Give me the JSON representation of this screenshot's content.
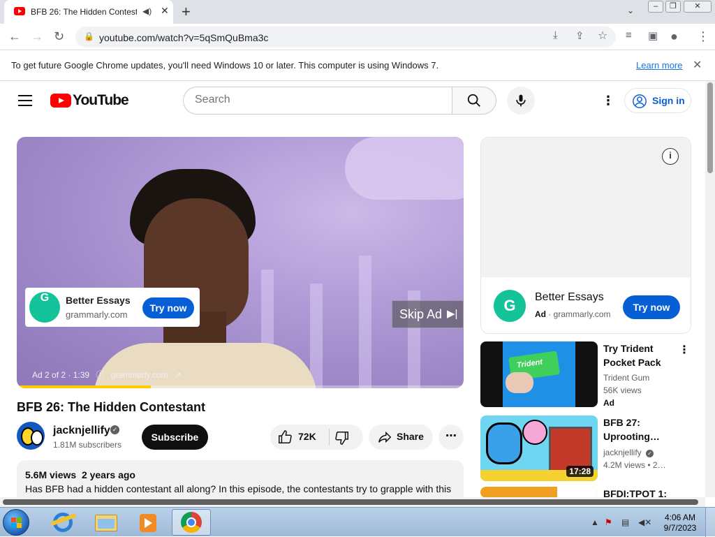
{
  "browser": {
    "tab_title": "BFB 26: The Hidden Contestant",
    "new_tab_label": "+",
    "url": "youtube.com/watch?v=5qSmQuBma3c",
    "info_bar": {
      "message": "To get future Google Chrome updates, you'll need Windows 10 or later. This computer is using Windows 7.",
      "link": "Learn more"
    }
  },
  "youtube": {
    "wordmark": "YouTube",
    "search_placeholder": "Search",
    "sign_in_label": "Sign in"
  },
  "player": {
    "ad_card": {
      "brand": "Better Essays",
      "domain": "grammarly.com",
      "cta": "Try now"
    },
    "skip_label": "Skip Ad",
    "ad_counter": "Ad 2 of 2 · 1:39",
    "ad_domain": "grammarly.com",
    "progress_fraction": 0.3
  },
  "video": {
    "title": "BFB 26: The Hidden Contestant",
    "channel": "jacknjellify",
    "subscribers": "1.81M subscribers",
    "subscribe_label": "Subscribe",
    "likes": "72K",
    "share_label": "Share",
    "views": "5.6M views",
    "age": "2 years ago",
    "description": "Has BFB had a hidden contestant all along? In this episode, the contestants try to grapple with this"
  },
  "sidebar": {
    "ad": {
      "brand": "Better Essays",
      "ad_label": "Ad",
      "domain": "grammarly.com",
      "cta": "Try now"
    },
    "items": [
      {
        "title": "Try Trident Pocket Pack",
        "channel": "Trident Gum",
        "views": "56K views",
        "badge": "Ad"
      },
      {
        "title": "BFB 27: Uprooting…",
        "channel": "jacknjellify",
        "views": "4.2M views",
        "age": "2…",
        "duration": "17:28"
      },
      {
        "title": "BFDI:TPOT 1:"
      }
    ]
  },
  "taskbar": {
    "time": "4:06 AM",
    "date": "9/7/2023"
  }
}
